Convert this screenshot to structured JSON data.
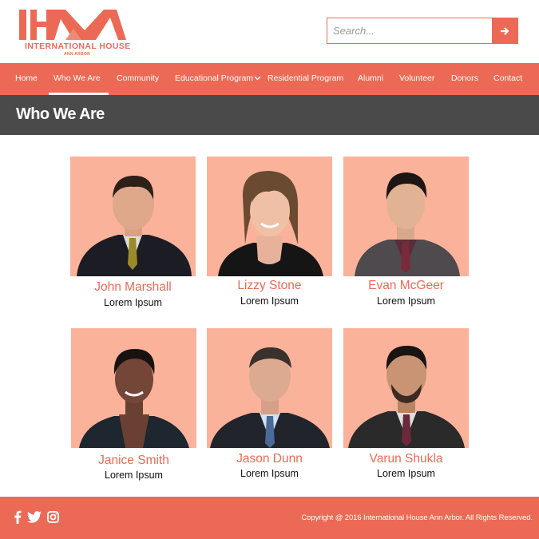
{
  "header": {
    "logo_text": "IHAA",
    "logo_line1": "INTERNATIONAL HOUSE",
    "logo_line2": "ANN ARBOR",
    "search_placeholder": "Search...",
    "search_button_icon": "arrow-right-icon"
  },
  "nav": {
    "items": [
      {
        "label": "Home"
      },
      {
        "label": "Who We Are"
      },
      {
        "label": "Community"
      },
      {
        "label": "Educational Program"
      },
      {
        "label": "Residential Program"
      },
      {
        "label": "Alumni"
      },
      {
        "label": "Volunteer"
      },
      {
        "label": "Donors"
      },
      {
        "label": "Contact"
      }
    ],
    "active": "Who We Are"
  },
  "page": {
    "title": "Who We Are"
  },
  "people": [
    {
      "name": "John Marshall",
      "role": "Lorem Ipsum"
    },
    {
      "name": "Lizzy Stone",
      "role": "Lorem Ipsum"
    },
    {
      "name": "Evan McGeer",
      "role": "Lorem Ipsum"
    },
    {
      "name": "Janice Smith",
      "role": "Lorem Ipsum"
    },
    {
      "name": "Jason Dunn",
      "role": "Lorem Ipsum"
    },
    {
      "name": "Varun Shukla",
      "role": "Lorem Ipsum"
    }
  ],
  "footer": {
    "social_icons": [
      "facebook-icon",
      "twitter-icon",
      "instagram-icon"
    ],
    "copyright": "Copyright @  2016 International House Ann Arbor. All Rights Reserved."
  },
  "colors": {
    "accent": "#ec6a55",
    "photo_bg": "#fbb29a",
    "title_bar": "#4a4a4a"
  }
}
